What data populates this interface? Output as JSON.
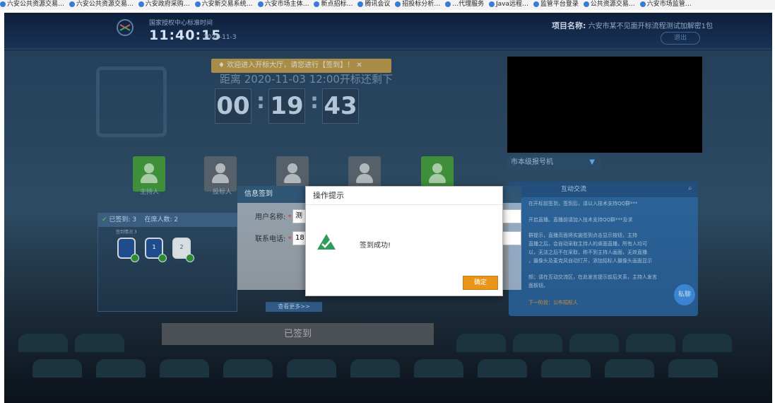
{
  "bookmarks": [
    "六安公共资源交易…",
    "六安公共资源交易…",
    "六安政府采购…",
    "六安新交易系统…",
    "六安市场主体…",
    "新点招标…",
    "腾讯会议",
    "招投标分析…",
    "…代理服务",
    "Java远程…",
    "监管平台登录",
    "公共资源交易…",
    "六安市场监管…"
  ],
  "header": {
    "clock_label": "国家授权中心标准时间",
    "time": "11:40:15",
    "date": "2020-11-3",
    "project_label": "项目名称:",
    "project_name": "六安市某不见面开标流程测试加解密1包",
    "top_button": "退出"
  },
  "countdown": {
    "notice": "欢迎进入开标大厅，请您进行【签到】！",
    "title": "距离 2020-11-03 12:00开标还剩下",
    "hours": "00",
    "minutes": "19",
    "seconds": "43"
  },
  "roles": [
    "主持人",
    "投标人",
    "",
    "",
    ""
  ],
  "info_dialog": {
    "title": "信息签到",
    "username_label": "用户名称:",
    "username_value": "测",
    "phone_label": "联系电话:",
    "phone_value": "18"
  },
  "status": {
    "signed": "已签到: 3",
    "online": "在席人数: 2",
    "mini_label": "签到情况 3",
    "seats": [
      "",
      "1",
      "2"
    ],
    "more": "查看更多>>",
    "signed_button": "已签到"
  },
  "chat": {
    "dropdown": "市本级报号机",
    "title": "互动交流",
    "lines": [
      "在开标前签到，签到后，请以入技术支持QQ群***",
      "开启直播。直播前请加入技术支持QQ群***及求",
      "群提示，直播页面将实施签到点击显示按钮，主持",
      "直播之后，会自动采取主持人的桌面直播，所有人均可",
      "以，无法之后不在采取，称不到主持人画面，无效直播",
      "，摄像头及麦克风自动打开，添加招标人摄像头画面显示",
      "频；请在互动交流区，在此发言提示前后关系，主持人发言",
      "面板钮。"
    ],
    "next": "下一阶段：公布招标人",
    "fab": "私聊"
  },
  "modal": {
    "title": "操作提示",
    "message": "签到成功!",
    "ok": "确定"
  },
  "colors": {
    "accent": "#e8951a",
    "success": "#2e9d5a",
    "brand": "#2f5675"
  }
}
